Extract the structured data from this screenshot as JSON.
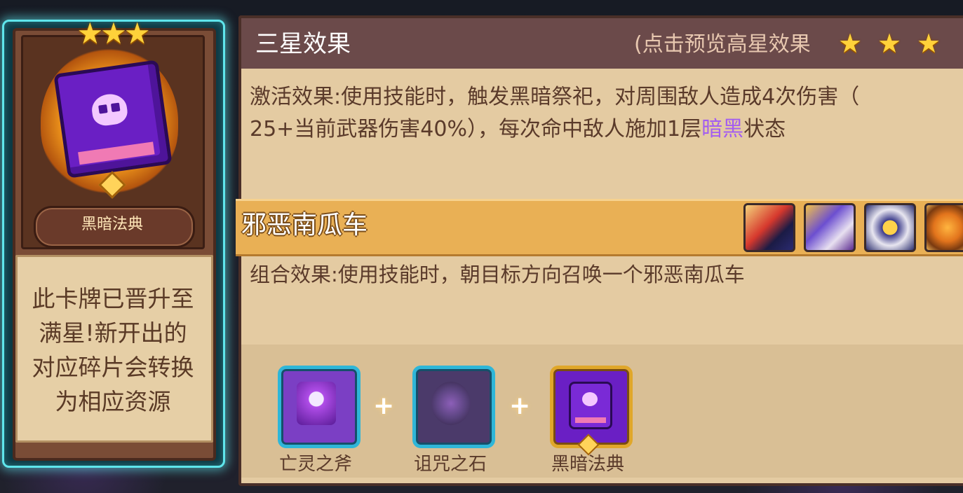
{
  "card": {
    "name": "黑暗法典",
    "stars": 3,
    "star_glyphs": "★★★",
    "description_lines": [
      "此卡牌已晋升至",
      "满星!新开出的",
      "对应碎片会转换",
      "为相应资源"
    ]
  },
  "panel": {
    "title": "三星效果",
    "preview_hint": "(点击预览高星效果",
    "star_glyph": "★",
    "effect": {
      "prefix": "激活效果:使用技能时，触发黑暗祭祀，对周围敌人造成4次伤害（",
      "line2_start": "25+当前武器伤害40%），每次命中敌人施加1层",
      "highlight": "暗黑",
      "suffix": "状态",
      "highlight_color": "#a35df0"
    }
  },
  "combo": {
    "title": "邪恶南瓜车",
    "effect": "组合效果:使用技能时，朝目标方向召唤一个邪恶南瓜车",
    "heroes": [
      "hero-portrait",
      "hero-portrait",
      "hero-portrait",
      "hero-portrait"
    ]
  },
  "pieces": {
    "items": [
      {
        "label": "亡灵之斧"
      },
      {
        "label": "诅咒之石"
      },
      {
        "label": "黑暗法典"
      }
    ],
    "plus": "+"
  },
  "colors": {
    "accent_glow": "#5fe6ec",
    "header_bg": "#6b4a4a",
    "combo_bar": "#e9b055",
    "panel_bg": "#e4cba2"
  }
}
